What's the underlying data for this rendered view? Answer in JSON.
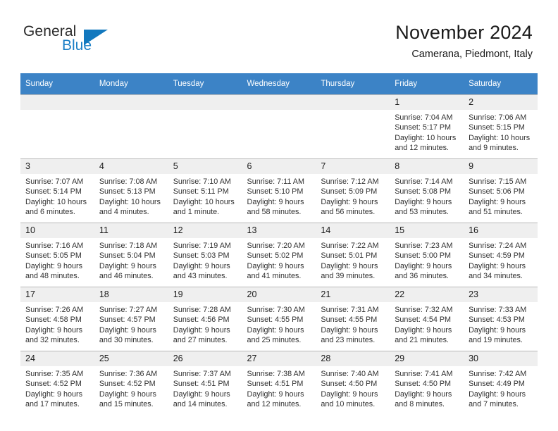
{
  "brand": {
    "word_general": "General",
    "word_blue": "Blue",
    "logo_icon": "triangle-logo-icon"
  },
  "header": {
    "title": "November 2024",
    "location": "Camerana, Piedmont, Italy"
  },
  "colors": {
    "header_blue": "#3c83c6",
    "brand_blue": "#1a7ec6",
    "daynum_bg": "#efefef",
    "grid_line": "#bfbfbf"
  },
  "calendar": {
    "weekday_headers": [
      "Sunday",
      "Monday",
      "Tuesday",
      "Wednesday",
      "Thursday",
      "Friday",
      "Saturday"
    ],
    "labels": {
      "sunrise": "Sunrise:",
      "sunset": "Sunset:",
      "daylight": "Daylight:"
    },
    "weeks": [
      [
        {
          "day": "",
          "empty": true
        },
        {
          "day": "",
          "empty": true
        },
        {
          "day": "",
          "empty": true
        },
        {
          "day": "",
          "empty": true
        },
        {
          "day": "",
          "empty": true
        },
        {
          "day": "1",
          "sunrise": "Sunrise: 7:04 AM",
          "sunset": "Sunset: 5:17 PM",
          "daylight1": "Daylight: 10 hours",
          "daylight2": "and 12 minutes."
        },
        {
          "day": "2",
          "sunrise": "Sunrise: 7:06 AM",
          "sunset": "Sunset: 5:15 PM",
          "daylight1": "Daylight: 10 hours",
          "daylight2": "and 9 minutes."
        }
      ],
      [
        {
          "day": "3",
          "sunrise": "Sunrise: 7:07 AM",
          "sunset": "Sunset: 5:14 PM",
          "daylight1": "Daylight: 10 hours",
          "daylight2": "and 6 minutes."
        },
        {
          "day": "4",
          "sunrise": "Sunrise: 7:08 AM",
          "sunset": "Sunset: 5:13 PM",
          "daylight1": "Daylight: 10 hours",
          "daylight2": "and 4 minutes."
        },
        {
          "day": "5",
          "sunrise": "Sunrise: 7:10 AM",
          "sunset": "Sunset: 5:11 PM",
          "daylight1": "Daylight: 10 hours",
          "daylight2": "and 1 minute."
        },
        {
          "day": "6",
          "sunrise": "Sunrise: 7:11 AM",
          "sunset": "Sunset: 5:10 PM",
          "daylight1": "Daylight: 9 hours",
          "daylight2": "and 58 minutes."
        },
        {
          "day": "7",
          "sunrise": "Sunrise: 7:12 AM",
          "sunset": "Sunset: 5:09 PM",
          "daylight1": "Daylight: 9 hours",
          "daylight2": "and 56 minutes."
        },
        {
          "day": "8",
          "sunrise": "Sunrise: 7:14 AM",
          "sunset": "Sunset: 5:08 PM",
          "daylight1": "Daylight: 9 hours",
          "daylight2": "and 53 minutes."
        },
        {
          "day": "9",
          "sunrise": "Sunrise: 7:15 AM",
          "sunset": "Sunset: 5:06 PM",
          "daylight1": "Daylight: 9 hours",
          "daylight2": "and 51 minutes."
        }
      ],
      [
        {
          "day": "10",
          "sunrise": "Sunrise: 7:16 AM",
          "sunset": "Sunset: 5:05 PM",
          "daylight1": "Daylight: 9 hours",
          "daylight2": "and 48 minutes."
        },
        {
          "day": "11",
          "sunrise": "Sunrise: 7:18 AM",
          "sunset": "Sunset: 5:04 PM",
          "daylight1": "Daylight: 9 hours",
          "daylight2": "and 46 minutes."
        },
        {
          "day": "12",
          "sunrise": "Sunrise: 7:19 AM",
          "sunset": "Sunset: 5:03 PM",
          "daylight1": "Daylight: 9 hours",
          "daylight2": "and 43 minutes."
        },
        {
          "day": "13",
          "sunrise": "Sunrise: 7:20 AM",
          "sunset": "Sunset: 5:02 PM",
          "daylight1": "Daylight: 9 hours",
          "daylight2": "and 41 minutes."
        },
        {
          "day": "14",
          "sunrise": "Sunrise: 7:22 AM",
          "sunset": "Sunset: 5:01 PM",
          "daylight1": "Daylight: 9 hours",
          "daylight2": "and 39 minutes."
        },
        {
          "day": "15",
          "sunrise": "Sunrise: 7:23 AM",
          "sunset": "Sunset: 5:00 PM",
          "daylight1": "Daylight: 9 hours",
          "daylight2": "and 36 minutes."
        },
        {
          "day": "16",
          "sunrise": "Sunrise: 7:24 AM",
          "sunset": "Sunset: 4:59 PM",
          "daylight1": "Daylight: 9 hours",
          "daylight2": "and 34 minutes."
        }
      ],
      [
        {
          "day": "17",
          "sunrise": "Sunrise: 7:26 AM",
          "sunset": "Sunset: 4:58 PM",
          "daylight1": "Daylight: 9 hours",
          "daylight2": "and 32 minutes."
        },
        {
          "day": "18",
          "sunrise": "Sunrise: 7:27 AM",
          "sunset": "Sunset: 4:57 PM",
          "daylight1": "Daylight: 9 hours",
          "daylight2": "and 30 minutes."
        },
        {
          "day": "19",
          "sunrise": "Sunrise: 7:28 AM",
          "sunset": "Sunset: 4:56 PM",
          "daylight1": "Daylight: 9 hours",
          "daylight2": "and 27 minutes."
        },
        {
          "day": "20",
          "sunrise": "Sunrise: 7:30 AM",
          "sunset": "Sunset: 4:55 PM",
          "daylight1": "Daylight: 9 hours",
          "daylight2": "and 25 minutes."
        },
        {
          "day": "21",
          "sunrise": "Sunrise: 7:31 AM",
          "sunset": "Sunset: 4:55 PM",
          "daylight1": "Daylight: 9 hours",
          "daylight2": "and 23 minutes."
        },
        {
          "day": "22",
          "sunrise": "Sunrise: 7:32 AM",
          "sunset": "Sunset: 4:54 PM",
          "daylight1": "Daylight: 9 hours",
          "daylight2": "and 21 minutes."
        },
        {
          "day": "23",
          "sunrise": "Sunrise: 7:33 AM",
          "sunset": "Sunset: 4:53 PM",
          "daylight1": "Daylight: 9 hours",
          "daylight2": "and 19 minutes."
        }
      ],
      [
        {
          "day": "24",
          "sunrise": "Sunrise: 7:35 AM",
          "sunset": "Sunset: 4:52 PM",
          "daylight1": "Daylight: 9 hours",
          "daylight2": "and 17 minutes."
        },
        {
          "day": "25",
          "sunrise": "Sunrise: 7:36 AM",
          "sunset": "Sunset: 4:52 PM",
          "daylight1": "Daylight: 9 hours",
          "daylight2": "and 15 minutes."
        },
        {
          "day": "26",
          "sunrise": "Sunrise: 7:37 AM",
          "sunset": "Sunset: 4:51 PM",
          "daylight1": "Daylight: 9 hours",
          "daylight2": "and 14 minutes."
        },
        {
          "day": "27",
          "sunrise": "Sunrise: 7:38 AM",
          "sunset": "Sunset: 4:51 PM",
          "daylight1": "Daylight: 9 hours",
          "daylight2": "and 12 minutes."
        },
        {
          "day": "28",
          "sunrise": "Sunrise: 7:40 AM",
          "sunset": "Sunset: 4:50 PM",
          "daylight1": "Daylight: 9 hours",
          "daylight2": "and 10 minutes."
        },
        {
          "day": "29",
          "sunrise": "Sunrise: 7:41 AM",
          "sunset": "Sunset: 4:50 PM",
          "daylight1": "Daylight: 9 hours",
          "daylight2": "and 8 minutes."
        },
        {
          "day": "30",
          "sunrise": "Sunrise: 7:42 AM",
          "sunset": "Sunset: 4:49 PM",
          "daylight1": "Daylight: 9 hours",
          "daylight2": "and 7 minutes."
        }
      ]
    ]
  }
}
